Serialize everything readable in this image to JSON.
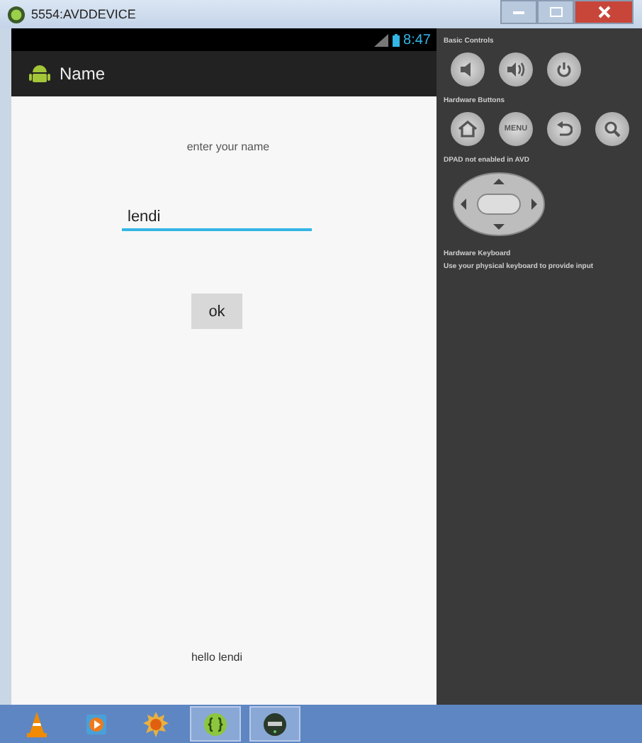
{
  "window": {
    "title": "5554:AVDDEVICE"
  },
  "status_bar": {
    "time": "8:47"
  },
  "action_bar": {
    "title": "Name"
  },
  "form": {
    "prompt": "enter your name",
    "name_field": {
      "value": "lendi"
    },
    "ok_button": "ok",
    "greeting": "hello lendi"
  },
  "controls": {
    "basic_heading": "Basic Controls",
    "hardware_heading": "Hardware Buttons",
    "menu_label": "MENU",
    "dpad_note": "DPAD not enabled in AVD",
    "keyboard_heading": "Hardware Keyboard",
    "keyboard_note": "Use your physical keyboard to provide input"
  },
  "taskbar": {
    "items": [
      {
        "kind": "cone",
        "selected": false
      },
      {
        "kind": "player",
        "selected": false
      },
      {
        "kind": "sun",
        "selected": false
      },
      {
        "kind": "braces",
        "selected": true
      },
      {
        "kind": "disc",
        "selected": true
      }
    ]
  }
}
